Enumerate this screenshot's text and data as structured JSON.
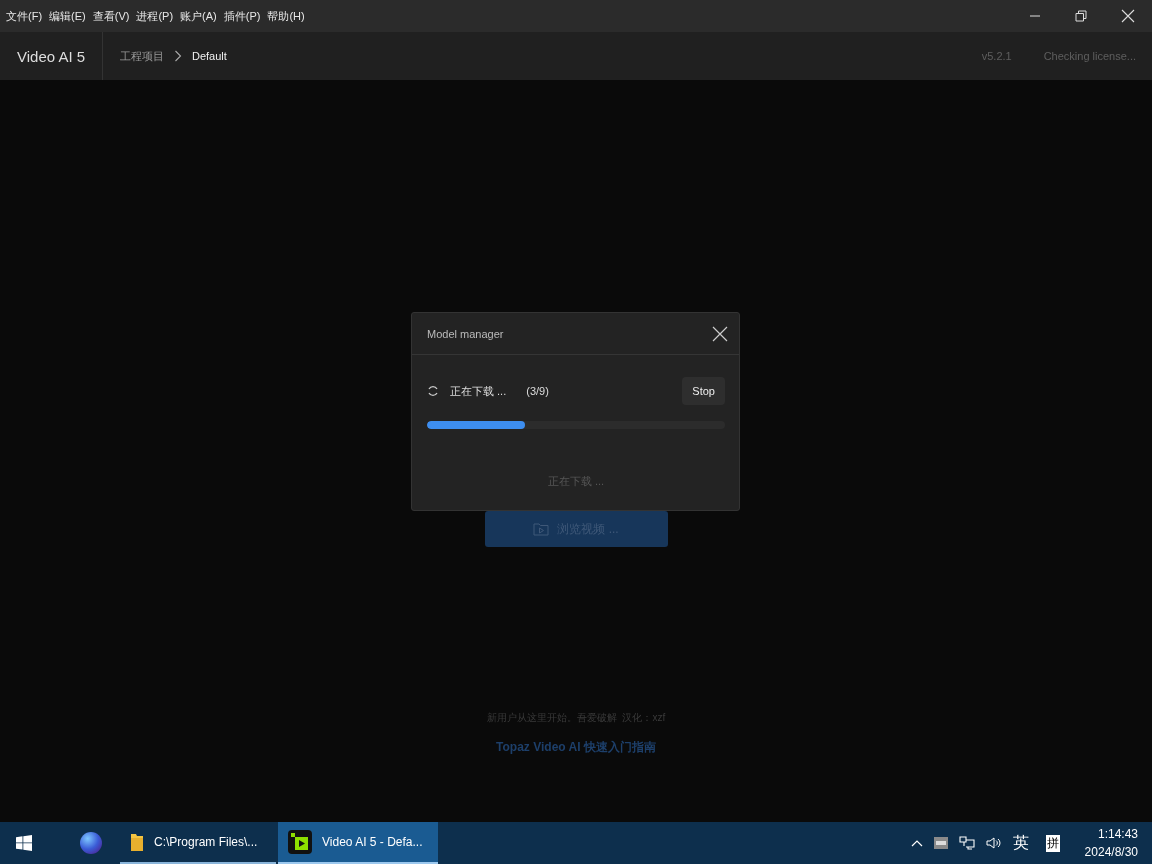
{
  "menu": [
    "文件(F)",
    "编辑(E)",
    "查看(V)",
    "进程(P)",
    "账户(A)",
    "插件(P)",
    "帮助(H)"
  ],
  "header": {
    "app_name": "Video AI 5",
    "breadcrumb": [
      "工程项目",
      "Default"
    ],
    "version": "v5.2.1",
    "license": "Checking license..."
  },
  "main": {
    "browse_button": "浏览视频 ...",
    "note": "新用户从这里开始。吾爱破解  汉化：xzf",
    "guide_link": "Topaz Video AI 快速入门指南"
  },
  "dialog": {
    "title": "Model manager",
    "status": "正在下载 ...",
    "count": "(3/9)",
    "stop_button": "Stop",
    "progress": {
      "level": 0.33
    },
    "message": "正在下载 ..."
  },
  "taskbar": {
    "items": [
      {
        "kind": "folder",
        "label": "C:\\Program Files\\...",
        "selected": false
      },
      {
        "kind": "app",
        "label": "Video AI 5 - Defa...",
        "selected": true
      }
    ],
    "ime": "英",
    "ime_mode": "拼",
    "time": "1:14:43",
    "date": "2024/8/30"
  }
}
